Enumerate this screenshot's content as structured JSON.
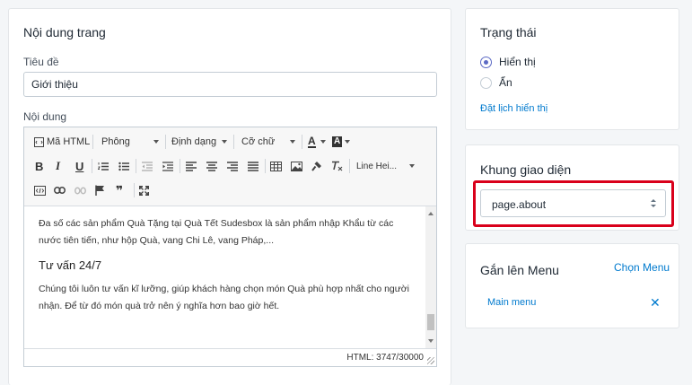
{
  "content_card": {
    "title": "Nội dung trang",
    "title_label": "Tiêu đề",
    "title_value": "Giới thiệu",
    "content_label": "Nội dung",
    "toolbar": {
      "source_label": "Mã HTML",
      "font_select": "Phông",
      "format_select": "Định dạng",
      "size_select": "Cỡ chữ",
      "line_height_select": "Line Hei...",
      "bold_glyph": "B",
      "italic_glyph": "I",
      "underline_glyph": "U",
      "text_color_glyph": "A",
      "bg_color_glyph": "A",
      "quote_glyph": "❞",
      "icons": [
        "code-icon",
        "font-color-icon",
        "background-color-icon",
        "ordered-list-icon",
        "bullet-list-icon",
        "outdent-icon",
        "indent-icon",
        "align-left-icon",
        "align-center-icon",
        "align-right-icon",
        "align-justify-icon",
        "table-icon",
        "image-icon",
        "paint-format-icon",
        "clear-format-icon",
        "source-code-icon",
        "link-icon",
        "unlink-icon",
        "flag-icon",
        "quote-icon",
        "fullscreen-icon"
      ]
    },
    "body": {
      "paragraph_1": "Đa số các sản phẩm Quà Tặng tại Quà Tết Sudesbox là sản phẩm nhập Khẩu từ các nước tiên tiến, như hộp Quà, vang Chi Lê, vang Pháp,...",
      "heading": "Tư vấn 24/7",
      "paragraph_2": "Chúng tôi luôn tư vấn kĩ lưỡng, giúp khách hàng chọn món Quà phù hợp nhất cho người nhận. Để từ đó món quà trở nên ý nghĩa hơn bao giờ hết."
    },
    "char_count": "HTML: 3747/30000"
  },
  "status_card": {
    "title": "Trạng thái",
    "options": [
      {
        "label": "Hiển thị",
        "selected": true
      },
      {
        "label": "Ẩn",
        "selected": false
      }
    ],
    "schedule_link": "Đặt lịch hiển thị"
  },
  "template_card": {
    "title": "Khung giao diện",
    "selected": "page.about",
    "highlight_color": "#d9001b"
  },
  "menu_card": {
    "title": "Gắn lên Menu",
    "choose_link": "Chọn Menu",
    "items": [
      {
        "label": "Main menu"
      }
    ],
    "remove_glyph": "✕"
  },
  "colors": {
    "link": "#007ace",
    "radio_accent": "#5c6ac4"
  }
}
